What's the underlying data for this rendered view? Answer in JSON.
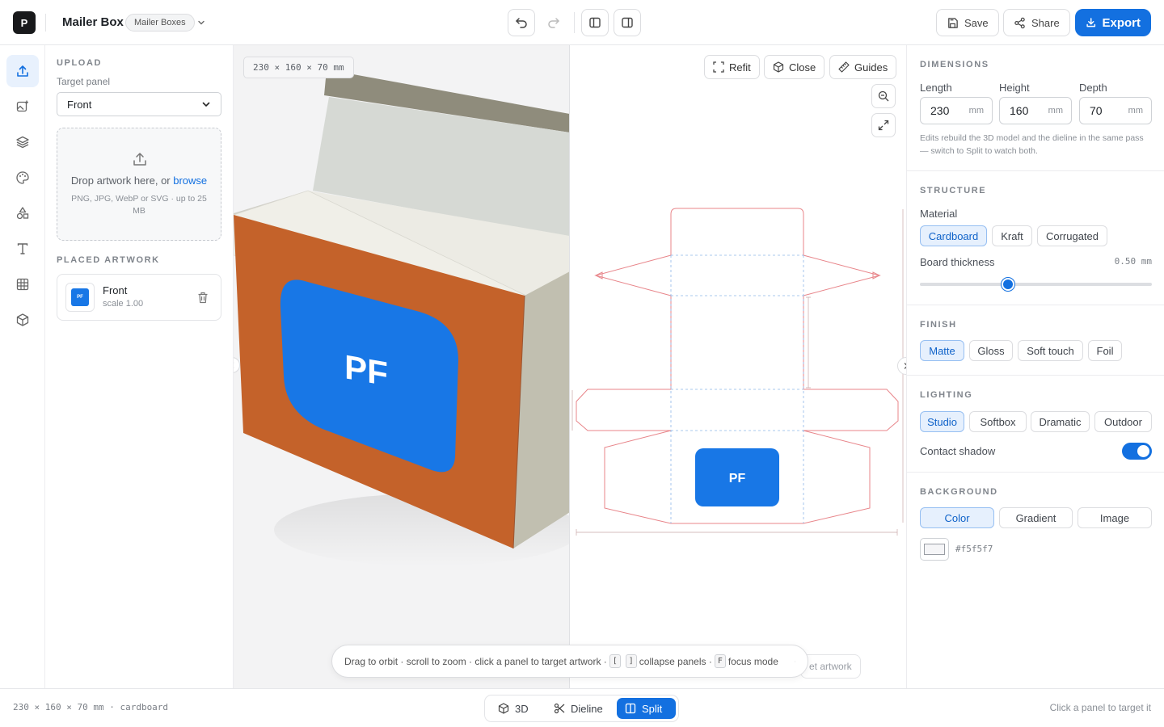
{
  "app": {
    "logo_letter": "P",
    "project_title": "Mailer Box",
    "category_badge": "Mailer Boxes"
  },
  "topbar": {
    "save_label": "Save",
    "share_label": "Share",
    "export_label": "Export"
  },
  "rail": {
    "items": [
      "upload-icon",
      "add-image-icon",
      "layers-icon",
      "palette-icon",
      "shapes-icon",
      "text-icon",
      "grid-icon",
      "box-icon"
    ],
    "active": "upload-icon"
  },
  "left": {
    "upload_title": "UPLOAD",
    "target_label": "Target panel",
    "target_value": "Front",
    "drop_text": "Drop artwork here, or ",
    "browse_link": "browse",
    "drop_hint": "PNG, JPG, WebP or SVG · up to 25 MB",
    "placed_title": "PLACED ARTWORK",
    "placed": {
      "name": "Front",
      "scale": "scale 1.00",
      "logo": "PF"
    }
  },
  "viewport3d": {
    "dimensions_tag": "230 × 160 × 70 mm",
    "logo_text": "PF"
  },
  "dieline": {
    "toolbar": [
      "Refit",
      "Close",
      "Guides"
    ],
    "logo_text": "PF"
  },
  "hint": {
    "text1": "Drag to orbit · scroll to zoom · click a panel to target artwork · ",
    "key1": "[",
    "key2": "]",
    "text2": " collapse panels · ",
    "key3": "F",
    "text3": " focus mode",
    "ghost": "et artwork"
  },
  "right": {
    "dimensions": {
      "title": "DIMENSIONS",
      "length_label": "Length",
      "length": "230",
      "height_label": "Height",
      "height": "160",
      "depth_label": "Depth",
      "depth": "70",
      "unit": "mm",
      "note": "Edits rebuild the 3D model and the dieline in the same pass — switch to Split to watch both."
    },
    "structure": {
      "title": "STRUCTURE",
      "material_label": "Material",
      "materials": [
        "Cardboard",
        "Kraft",
        "Corrugated"
      ],
      "selected_material": "Cardboard",
      "thickness_label": "Board thickness",
      "thickness_value": "0.50 mm",
      "thickness_fraction": 0.38
    },
    "finish": {
      "title": "FINISH",
      "options": [
        "Matte",
        "Gloss",
        "Soft touch",
        "Foil"
      ],
      "selected": "Matte"
    },
    "lighting": {
      "title": "LIGHTING",
      "options": [
        "Studio",
        "Softbox",
        "Dramatic",
        "Outdoor"
      ],
      "selected": "Studio",
      "shadow_label": "Contact shadow",
      "shadow_on": true
    },
    "background": {
      "title": "BACKGROUND",
      "options": [
        "Color",
        "Gradient",
        "Image"
      ],
      "selected": "Color",
      "color_value": "#f5f5f7"
    }
  },
  "bottom": {
    "status": "230 × 160 × 70 mm · cardboard",
    "modes": [
      "3D",
      "Dieline",
      "Split"
    ],
    "selected_mode": "Split",
    "right_hint": "Click a panel to target it"
  },
  "colors": {
    "accent": "#1370e0",
    "box_front": "#c4622a",
    "artwork": "#1877e6",
    "dieline": "#e8858a"
  }
}
